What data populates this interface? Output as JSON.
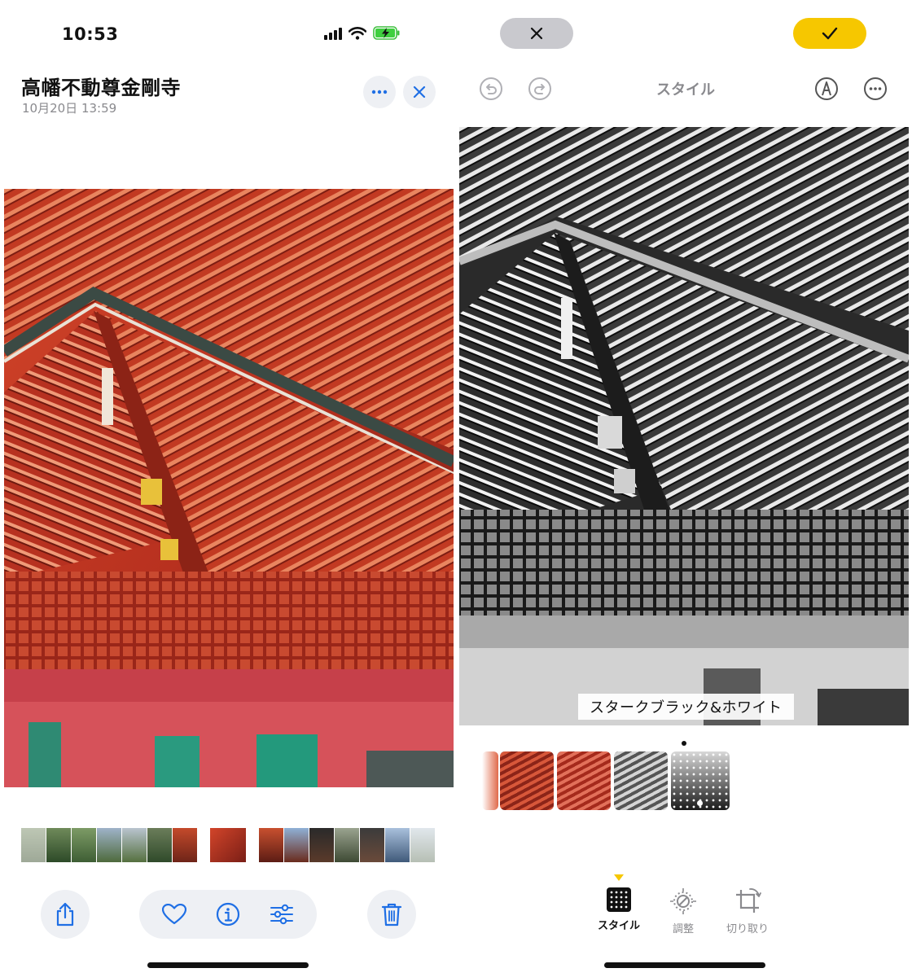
{
  "left": {
    "status_time": "10:53",
    "title": "高幡不動尊金剛寺",
    "date": "10月20日  13:59",
    "more_icon": "ellipsis-icon",
    "close_icon": "close-icon",
    "share_icon": "share-icon",
    "favorite_icon": "heart-icon",
    "info_icon": "info-icon",
    "edit_icon": "sliders-icon",
    "delete_icon": "trash-icon"
  },
  "right": {
    "cancel_icon": "close-icon",
    "done_icon": "checkmark-icon",
    "undo_icon": "undo-icon",
    "redo_icon": "redo-icon",
    "toolbar_title": "スタイル",
    "markup_icon": "markup-pen-icon",
    "more_icon": "ellipsis-icon",
    "style_name": "スタークブラック&ホワイト",
    "tabs": [
      {
        "label": "スタイル",
        "icon": "style-grid-icon",
        "selected": true
      },
      {
        "label": "調整",
        "icon": "adjust-dial-icon",
        "selected": false
      },
      {
        "label": "切り取り",
        "icon": "crop-rotate-icon",
        "selected": false
      }
    ]
  },
  "colors": {
    "accent_blue": "#1f6fe5",
    "done_yellow": "#f6c700",
    "button_gray": "#eef0f4",
    "cancel_gray": "#c9c9ce",
    "secondary_text": "#8a8a8e"
  }
}
